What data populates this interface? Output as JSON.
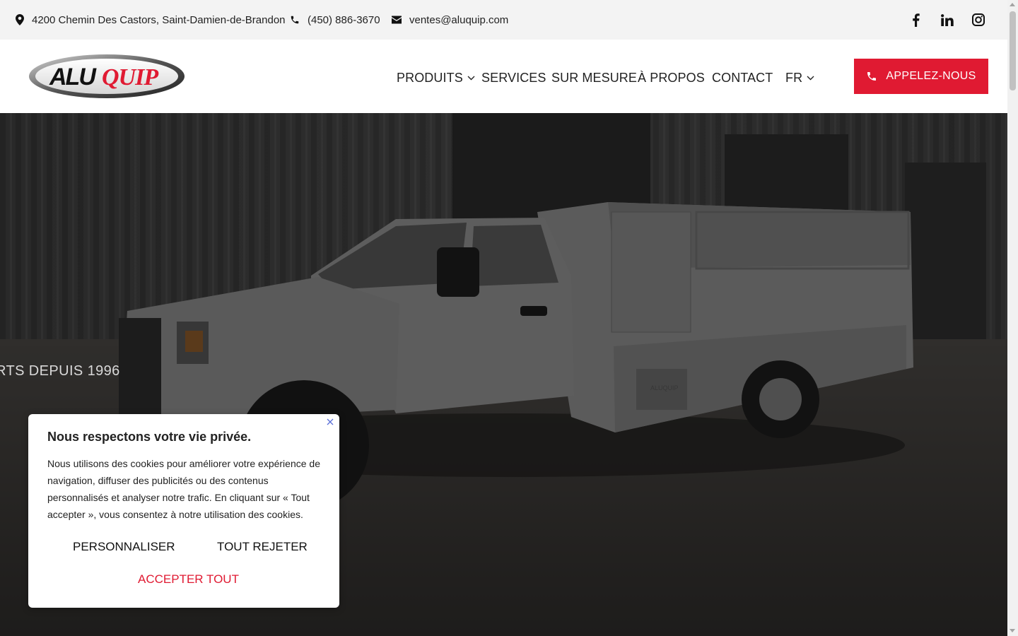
{
  "topbar": {
    "address": "4200 Chemin Des Castors, Saint-Damien-de-Brandon",
    "phone": "(450) 886-3670",
    "email": "ventes@aluquip.com",
    "social": [
      "facebook-icon",
      "linkedin-icon",
      "instagram-icon"
    ]
  },
  "header": {
    "logo_text_a": "ALU",
    "logo_text_b": "QUIP",
    "nav": {
      "produits": "PRODUITS",
      "services": "SERVICES",
      "sur_mesure": "SUR MESURE",
      "a_propos": "À PROPOS",
      "contact": "CONTACT",
      "lang": "FR"
    },
    "call_button": "APPELEZ-NOUS"
  },
  "hero": {
    "tagline": "RTS DEPUIS 1996",
    "truck_logo_text": "ALUQUIP"
  },
  "cookie": {
    "title": "Nous respectons votre vie privée.",
    "text": "Nous utilisons des cookies pour améliorer votre expérience de navigation, diffuser des publicités ou des contenus personnalisés et analyser notre trafic. En cliquant sur « Tout accepter », vous consentez à notre utilisation des cookies.",
    "customize": "PERSONNALISER",
    "reject": "TOUT REJETER",
    "accept": "ACCEPTER TOUT"
  },
  "colors": {
    "accent": "#e01a32",
    "topbar_bg": "#f3f3f3",
    "text": "#222222"
  }
}
